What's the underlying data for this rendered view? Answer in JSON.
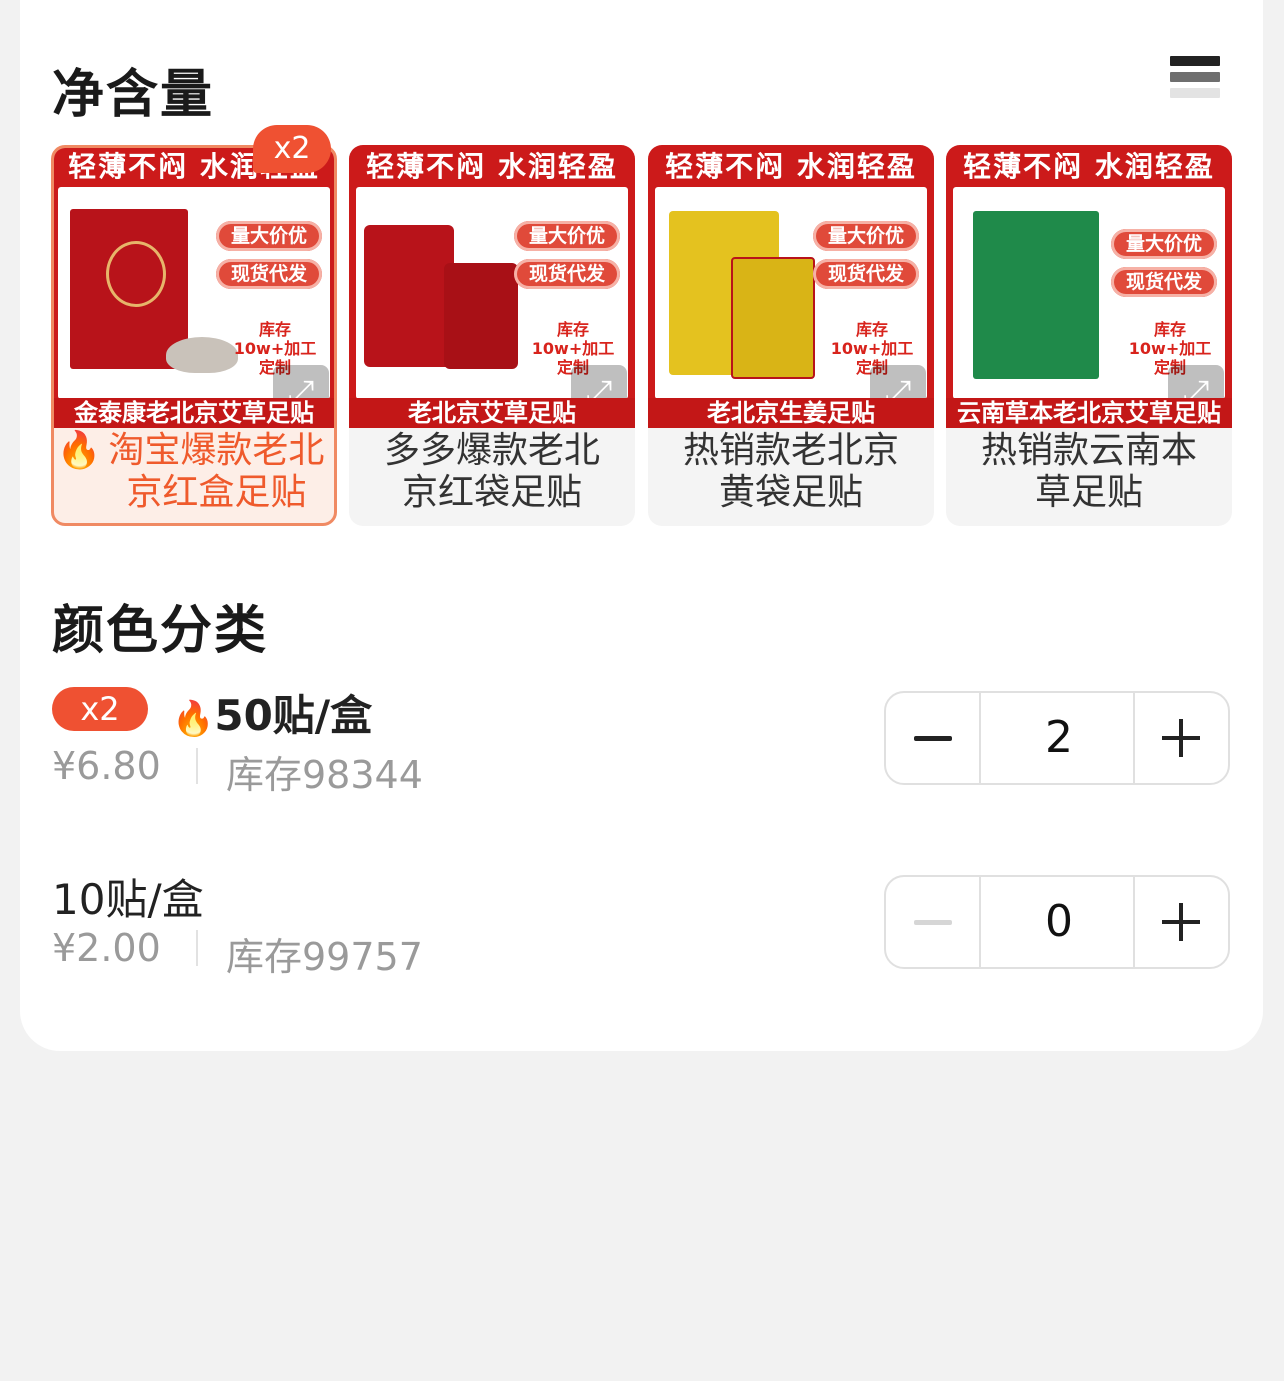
{
  "sections": {
    "net_content_title": "净含量",
    "color_title": "颜色分类"
  },
  "product_cards": [
    {
      "image_top": "轻薄不闷 水润轻盈",
      "image_tags": [
        "量大价优",
        "现货代发"
      ],
      "image_stock_note": "库存10w+加工定制",
      "image_bottom": "金泰康老北京艾草足贴",
      "label": "淘宝爆款老北京红盒足贴",
      "label_icon": "fire-icon",
      "selected": true,
      "count_badge": "x2"
    },
    {
      "image_top": "轻薄不闷 水润轻盈",
      "image_tags": [
        "量大价优",
        "现货代发"
      ],
      "image_stock_note": "库存10w+加工定制",
      "image_bottom": "老北京艾草足贴",
      "label": "多多爆款老北京红袋足贴",
      "selected": false
    },
    {
      "image_top": "轻薄不闷 水润轻盈",
      "image_tags": [
        "量大价优",
        "现货代发"
      ],
      "image_stock_note": "库存10w+加工定制",
      "image_bottom": "老北京生姜足贴",
      "label": "热销款老北京黄袋足贴",
      "selected": false
    },
    {
      "image_top": "轻薄不闷 水润轻盈",
      "image_tags": [
        "量大价优",
        "现货代发"
      ],
      "image_stock_note": "库存10w+加工定制",
      "image_bottom": "云南草本老北京艾草足贴",
      "label": "热销款云南本草足贴",
      "selected": false
    }
  ],
  "variants": [
    {
      "badge": "x2",
      "icon": "fire-icon",
      "name": "50贴/盒",
      "price": "¥6.80",
      "stock": "库存98344",
      "quantity": "2",
      "minus_enabled": true
    },
    {
      "name": "10贴/盒",
      "price": "¥2.00",
      "stock": "库存99757",
      "quantity": "0",
      "minus_enabled": false
    }
  ],
  "colors": {
    "accent": "#ef5132",
    "selected_border": "#f08a63",
    "selected_bg": "#fdeee7",
    "product_red": "#cc1a1a"
  }
}
